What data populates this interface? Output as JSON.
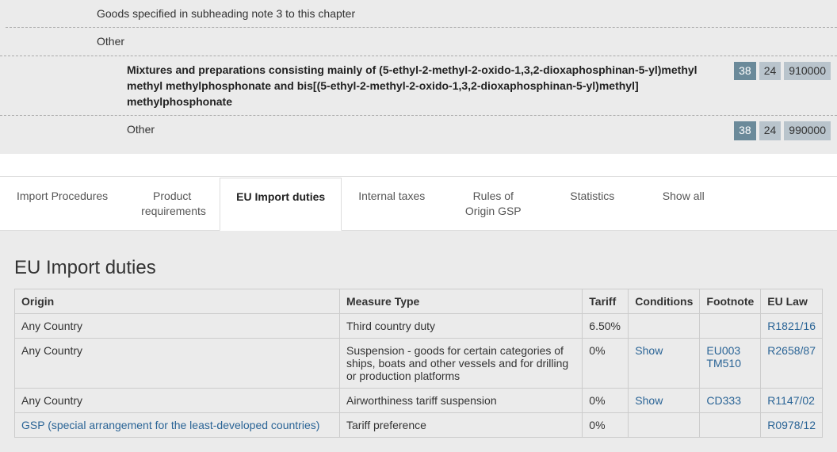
{
  "tree": {
    "row0": {
      "desc": "Goods specified in subheading note 3 to this chapter"
    },
    "row1": {
      "desc": "Other"
    },
    "row2": {
      "desc": "Mixtures and preparations consisting mainly of (5-ethyl-2-methyl-2-oxido-1,3,2-dioxaphosphinan-5-yl)methyl methyl methylphosphonate and bis[(5-ethyl-2-methyl-2-oxido-1,3,2-dioxaphosphinan-5-yl)methyl] methylphosphonate",
      "c1": "38",
      "c2": "24",
      "c3": "910000"
    },
    "row3": {
      "desc": "Other",
      "c1": "38",
      "c2": "24",
      "c3": "990000"
    }
  },
  "tabs": {
    "t0": "Import Procedures",
    "t1": "Product requirements",
    "t2": "EU Import duties",
    "t3": "Internal taxes",
    "t4": "Rules of Origin GSP",
    "t5": "Statistics",
    "t6": "Show all"
  },
  "section": {
    "title": "EU Import duties"
  },
  "table": {
    "head": {
      "origin": "Origin",
      "measure": "Measure Type",
      "tariff": "Tariff",
      "conditions": "Conditions",
      "footnote": "Footnote",
      "law": "EU Law"
    },
    "r0": {
      "origin": "Any Country",
      "measure": "Third country duty",
      "tariff": "6.50%",
      "law": "R1821/16"
    },
    "r1": {
      "origin": "Any Country",
      "measure": "Suspension - goods for certain categories of ships, boats and other vessels and for drilling or production platforms",
      "tariff": "0%",
      "cond": "Show",
      "fn1": "EU003",
      "fn2": "TM510",
      "law": "R2658/87"
    },
    "r2": {
      "origin": "Any Country",
      "measure": "Airworthiness tariff suspension",
      "tariff": "0%",
      "cond": "Show",
      "fn1": "CD333",
      "law": "R1147/02"
    },
    "r3": {
      "origin": "GSP (special arrangement for the least-developed countries)",
      "measure": "Tariff preference",
      "tariff": "0%",
      "law": "R0978/12"
    }
  }
}
